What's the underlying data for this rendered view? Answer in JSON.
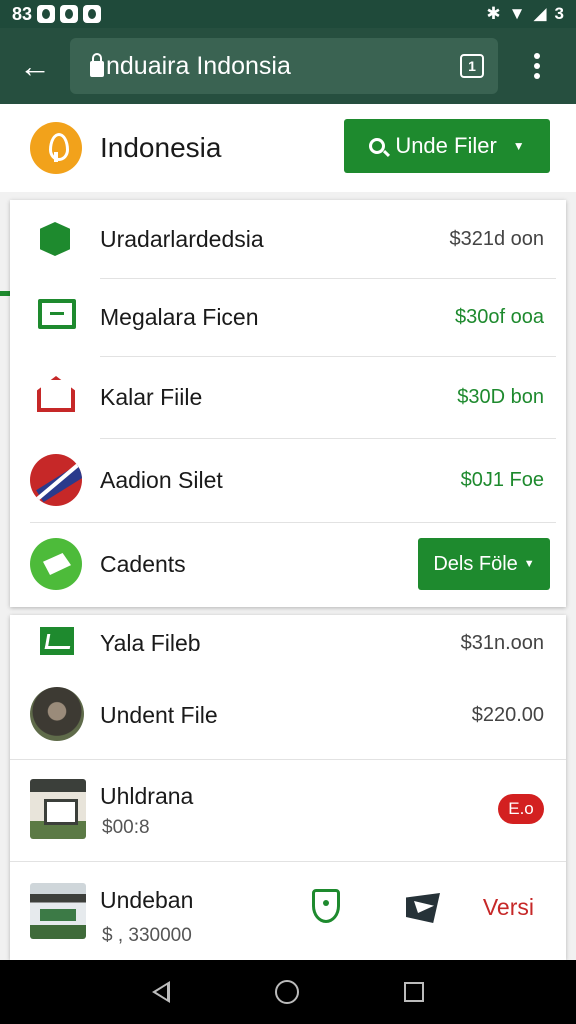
{
  "status_bar": {
    "time": "83",
    "right_text": "3"
  },
  "app_bar": {
    "url": "nduaira Indonsia"
  },
  "header": {
    "title": "Indonesia",
    "button_label": "Unde Filer"
  },
  "list_top": [
    {
      "name": "Uradarlardedsia",
      "price": "$321d oon",
      "price_color": "#444444",
      "icon": "box-icon"
    },
    {
      "name": "Megalara Ficen",
      "price": "$30of ooa",
      "price_color": "#1e8a2e",
      "icon": "card-icon"
    },
    {
      "name": "Kalar Fiile",
      "price": "$30D bon",
      "price_color": "#1e8a2e",
      "icon": "house-icon"
    },
    {
      "name": "Aadion Silet",
      "price": "$0J1 Foe",
      "price_color": "#1e8a2e",
      "icon": "flag-icon"
    },
    {
      "name": "Cadents",
      "button": "Dels Föle",
      "icon": "leaf-icon"
    }
  ],
  "list_bottom": [
    {
      "name": "Yala Fileb",
      "price": "$31n.oon",
      "icon": "mail-icon"
    },
    {
      "name": "Undent File",
      "price": "$220.00",
      "icon": "photo-avatar"
    },
    {
      "name": "Uhldrana",
      "sub": "$00:8",
      "badge": "E.o",
      "icon": "house-thumbnail"
    },
    {
      "name": "Undeban",
      "sub": "$ , 330000",
      "action": "Versi",
      "icon": "building-thumbnail"
    }
  ],
  "colors": {
    "accent": "#1e8a2e",
    "app_bar": "#264f3f",
    "danger": "#c62828",
    "brand": "#f2a21b"
  }
}
